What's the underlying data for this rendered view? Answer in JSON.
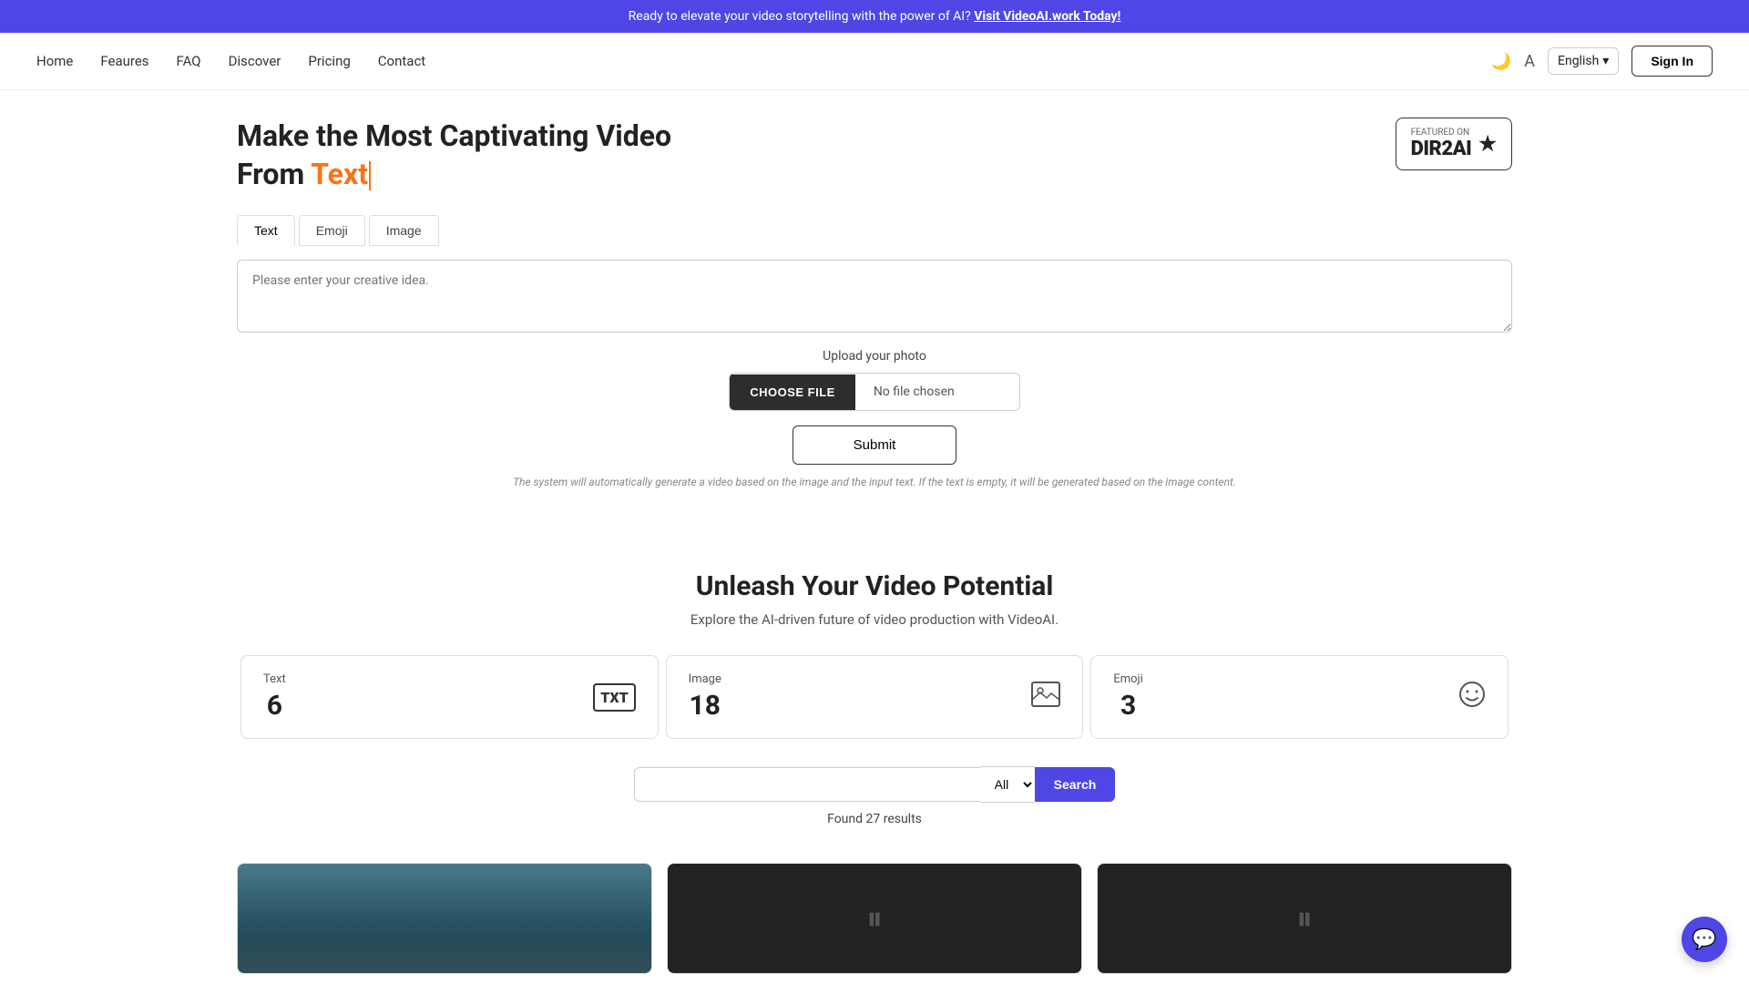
{
  "banner": {
    "text": "Ready to elevate your video storytelling with the power of AI?",
    "link_text": "Visit VideoAI.work Today!"
  },
  "nav": {
    "links": [
      {
        "label": "Home",
        "id": "home"
      },
      {
        "label": "Feaures",
        "id": "features"
      },
      {
        "label": "FAQ",
        "id": "faq"
      },
      {
        "label": "Discover",
        "id": "discover"
      },
      {
        "label": "Pricing",
        "id": "pricing"
      },
      {
        "label": "Contact",
        "id": "contact"
      }
    ],
    "language": "English",
    "signin_label": "Sign In"
  },
  "hero": {
    "title_part1": "Make the Most Captivating Video",
    "title_part2": "From ",
    "title_highlight": "Text",
    "badge": {
      "featured_on": "FEATURED ON",
      "name": "DIR2AI",
      "star": "★"
    }
  },
  "tabs": [
    {
      "label": "Text",
      "id": "text",
      "active": true
    },
    {
      "label": "Emoji",
      "id": "emoji",
      "active": false
    },
    {
      "label": "Image",
      "id": "image",
      "active": false
    }
  ],
  "textarea": {
    "placeholder": "Please enter your creative idea."
  },
  "upload": {
    "label": "Upload your photo",
    "choose_label": "CHOOSE FILE",
    "no_file": "No file chosen"
  },
  "submit": {
    "label": "Submit"
  },
  "note": {
    "text": "The system will automatically generate a video based on the image and the input text. If the text is empty, it will be generated based on the image content."
  },
  "unleash": {
    "title": "Unleash Your Video Potential",
    "subtitle": "Explore the AI-driven future of video production with VideoAI."
  },
  "stats": [
    {
      "label": "Text",
      "number": "6",
      "icon": "TXT"
    },
    {
      "label": "Image",
      "number": "18",
      "icon": "🖼"
    },
    {
      "label": "Emoji",
      "number": "3",
      "icon": "🙂"
    }
  ],
  "search": {
    "placeholder": "",
    "filter_option": "All",
    "button_label": "Search",
    "results_text": "Found 27 results"
  },
  "chat_button": {
    "icon": "💬"
  }
}
